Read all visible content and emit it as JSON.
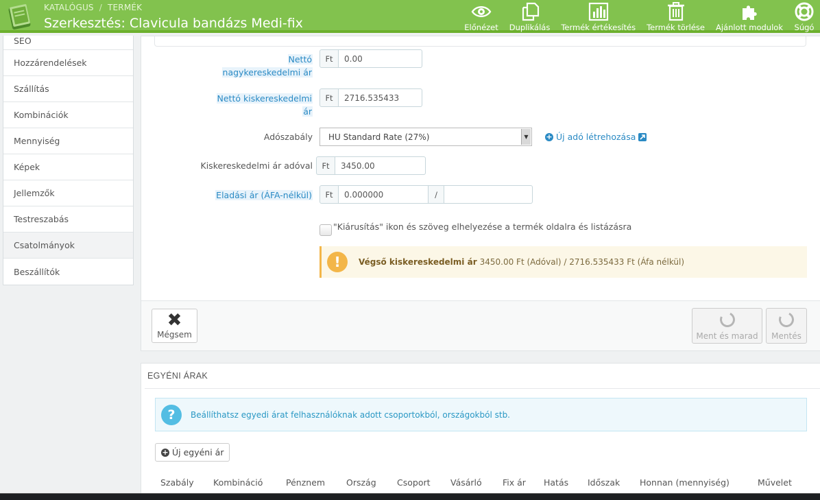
{
  "header": {
    "breadcrumb": [
      "KATALÓGUS",
      "TERMÉK"
    ],
    "breadcrumb_sep": "/",
    "title": "Szerkesztés: Clavicula bandázs Medi-fix",
    "toolbar": [
      {
        "label": "Előnézet",
        "icon": "eye-icon"
      },
      {
        "label": "Duplikálás",
        "icon": "copy-icon"
      },
      {
        "label": "Termék értékesítés",
        "icon": "bar-chart-icon"
      },
      {
        "label": "Termék törlése",
        "icon": "trash-icon"
      },
      {
        "label": "Ajánlott modulok",
        "icon": "puzzle-icon"
      },
      {
        "label": "Súgó",
        "icon": "lifebuoy-icon"
      }
    ]
  },
  "sidebar": {
    "items": [
      {
        "label": "SEO"
      },
      {
        "label": "Hozzárendelések"
      },
      {
        "label": "Szállítás"
      },
      {
        "label": "Kombinációk"
      },
      {
        "label": "Mennyiség"
      },
      {
        "label": "Képek"
      },
      {
        "label": "Jellemzők"
      },
      {
        "label": "Testreszabás"
      },
      {
        "label": "Csatolmányok"
      },
      {
        "label": "Beszállítók"
      }
    ]
  },
  "form": {
    "wholesale": {
      "label_1": "Nettó",
      "label_2": "nagykereskedelmi ár",
      "currency": "Ft",
      "value": "0.00"
    },
    "retail": {
      "label_1": "Nettó kiskereskedelmi",
      "label_2": "ár",
      "currency": "Ft",
      "value": "2716.535433"
    },
    "tax": {
      "label": "Adószabály",
      "selected": "HU Standard Rate (27%)",
      "new_tax_link": "Új adó létrehozása"
    },
    "retail_with_tax": {
      "label": "Kiskereskedelmi ár adóval",
      "currency": "Ft",
      "value": "3450.00"
    },
    "unit_price": {
      "label": "Eladási ár (ÁFA-nélkül)",
      "currency": "Ft",
      "value": "0.000000",
      "sep": "/",
      "unit": ""
    },
    "on_sale": {
      "label": "\"Kiárusítás\" ikon és szöveg elhelyezése a termék oldalra és listázásra",
      "checked": false
    },
    "final_price": {
      "label": "Végső kiskereskedelmi ár",
      "text": "3450.00 Ft (Adóval) / 2716.535433 Ft (Áfa nélkül)"
    }
  },
  "actions": {
    "cancel": "Mégsem",
    "save_stay": "Ment és marad",
    "save": "Mentés"
  },
  "specific_prices": {
    "title": "EGYÉNI ÁRAK",
    "info": "Beállíthatsz egyedi árat felhasználóknak adott csoportokból, országokból stb.",
    "add_button": "Új egyéni ár",
    "columns": [
      "Szabály",
      "Kombináció",
      "Pénznem",
      "Ország",
      "Csoport",
      "Vásárló",
      "Fix ár",
      "Hatás",
      "Időszak",
      "Honnan (mennyiség)",
      "Művelet"
    ]
  },
  "colors": {
    "header": "#82c24e",
    "link": "#2a8ac4",
    "warning": "#f3b649",
    "info": "#53bde3"
  }
}
